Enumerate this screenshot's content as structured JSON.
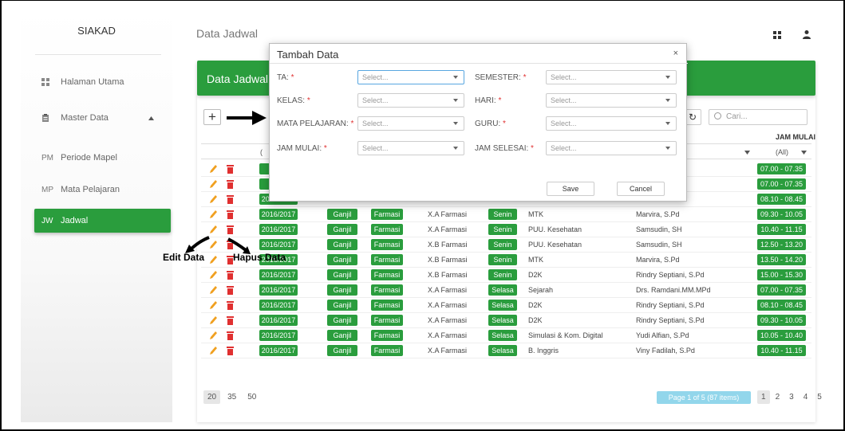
{
  "app": {
    "brand": "SIAKAD",
    "page_title": "Data Jadwal"
  },
  "sidebar": {
    "items": [
      {
        "label": "Halaman Utama",
        "icon": "dashboard-icon"
      },
      {
        "label": "Master Data",
        "icon": "clipboard-icon"
      }
    ],
    "sub_items": [
      {
        "abbr": "PM",
        "label": "Periode Mapel"
      },
      {
        "abbr": "MP",
        "label": "Mata Pelajaran"
      },
      {
        "abbr": "JW",
        "label": "Jadwal"
      }
    ]
  },
  "card": {
    "title": "Data Jadwal"
  },
  "toolbar": {
    "add_label": "+",
    "refresh_label": "↻",
    "search_placeholder": "Cari..."
  },
  "grid": {
    "visible_header": "JAM MULAI",
    "filter_all": "(All)",
    "filter_left": "(",
    "rows": [
      {
        "ta": "20",
        "sem": "",
        "jur": "",
        "kelas": "",
        "hari": "",
        "mapel": "",
        "guru": "S.Pd",
        "jam": "07.00 - 07.35"
      },
      {
        "ta": "20",
        "sem": "",
        "jur": "",
        "kelas": "",
        "hari": "",
        "mapel": "",
        "guru": "S.Pd",
        "jam": "07.00 - 07.35"
      },
      {
        "ta": "2016/2017",
        "sem": "",
        "jur": "",
        "kelas": "",
        "hari": "",
        "mapel": "",
        "guru": "",
        "jam": "08.10 - 08.45"
      },
      {
        "ta": "2016/2017",
        "sem": "Ganjil",
        "jur": "Farmasi",
        "kelas": "X.A Farmasi",
        "hari": "Senin",
        "mapel": "MTK",
        "guru": "Marvira, S.Pd",
        "jam": "09.30 - 10.05"
      },
      {
        "ta": "2016/2017",
        "sem": "Ganjil",
        "jur": "Farmasi",
        "kelas": "X.A Farmasi",
        "hari": "Senin",
        "mapel": "PUU. Kesehatan",
        "guru": "Samsudin, SH",
        "jam": "10.40 - 11.15"
      },
      {
        "ta": "2016/2017",
        "sem": "Ganjil",
        "jur": "Farmasi",
        "kelas": "X.B Farmasi",
        "hari": "Senin",
        "mapel": "PUU. Kesehatan",
        "guru": "Samsudin, SH",
        "jam": "12.50 - 13.20"
      },
      {
        "ta": "2016/2017",
        "sem": "Ganjil",
        "jur": "Farmasi",
        "kelas": "X.B Farmasi",
        "hari": "Senin",
        "mapel": "MTK",
        "guru": "Marvira, S.Pd",
        "jam": "13.50 - 14.20"
      },
      {
        "ta": "2016/2017",
        "sem": "Ganjil",
        "jur": "Farmasi",
        "kelas": "X.B Farmasi",
        "hari": "Senin",
        "mapel": "D2K",
        "guru": "Rindry Septiani, S.Pd",
        "jam": "15.00 - 15.30"
      },
      {
        "ta": "2016/2017",
        "sem": "Ganjil",
        "jur": "Farmasi",
        "kelas": "X.A Farmasi",
        "hari": "Selasa",
        "mapel": "Sejarah",
        "guru": "Drs. Ramdani.MM.MPd",
        "jam": "07.00 - 07.35"
      },
      {
        "ta": "2016/2017",
        "sem": "Ganjil",
        "jur": "Farmasi",
        "kelas": "X.A Farmasi",
        "hari": "Selasa",
        "mapel": "D2K",
        "guru": "Rindry Septiani, S.Pd",
        "jam": "08.10 - 08.45"
      },
      {
        "ta": "2016/2017",
        "sem": "Ganjil",
        "jur": "Farmasi",
        "kelas": "X.A Farmasi",
        "hari": "Selasa",
        "mapel": "D2K",
        "guru": "Rindry Septiani, S.Pd",
        "jam": "09.30 - 10.05"
      },
      {
        "ta": "2016/2017",
        "sem": "Ganjil",
        "jur": "Farmasi",
        "kelas": "X.A Farmasi",
        "hari": "Selasa",
        "mapel": "Simulasi & Kom. Digital",
        "guru": "Yudi Alfian, S.Pd",
        "jam": "10.05 - 10.40"
      },
      {
        "ta": "2016/2017",
        "sem": "Ganjil",
        "jur": "Farmasi",
        "kelas": "X.A Farmasi",
        "hari": "Selasa",
        "mapel": "B. Inggris",
        "guru": "Viny Fadilah, S.Pd",
        "jam": "10.40 - 11.15"
      }
    ]
  },
  "pager": {
    "sizes": [
      "20",
      "35",
      "50"
    ],
    "info": "Page 1 of 5 (87 items)",
    "pages": [
      "1",
      "2",
      "3",
      "4",
      "5"
    ]
  },
  "dialog": {
    "title": "Tambah Data",
    "close": "×",
    "fields": [
      {
        "label": "TA:",
        "value": "Select..."
      },
      {
        "label": "SEMESTER:",
        "value": "Select..."
      },
      {
        "label": "KELAS:",
        "value": "Select..."
      },
      {
        "label": "HARI:",
        "value": "Select..."
      },
      {
        "label": "MATA PELAJARAN:",
        "value": "Select..."
      },
      {
        "label": "GURU:",
        "value": "Select..."
      },
      {
        "label": "JAM MULAI:",
        "value": "Select..."
      },
      {
        "label": "JAM SELESAI:",
        "value": "Select..."
      }
    ],
    "required_mark": "*",
    "save_label": "Save",
    "cancel_label": "Cancel"
  },
  "annotations": {
    "edit": "Edit Data",
    "hapus": "Hapus Data"
  },
  "colors": {
    "primary": "#2a9d3d",
    "delete": "#e03030",
    "edit": "#f0a020",
    "pager_info": "#7fd0e8"
  }
}
